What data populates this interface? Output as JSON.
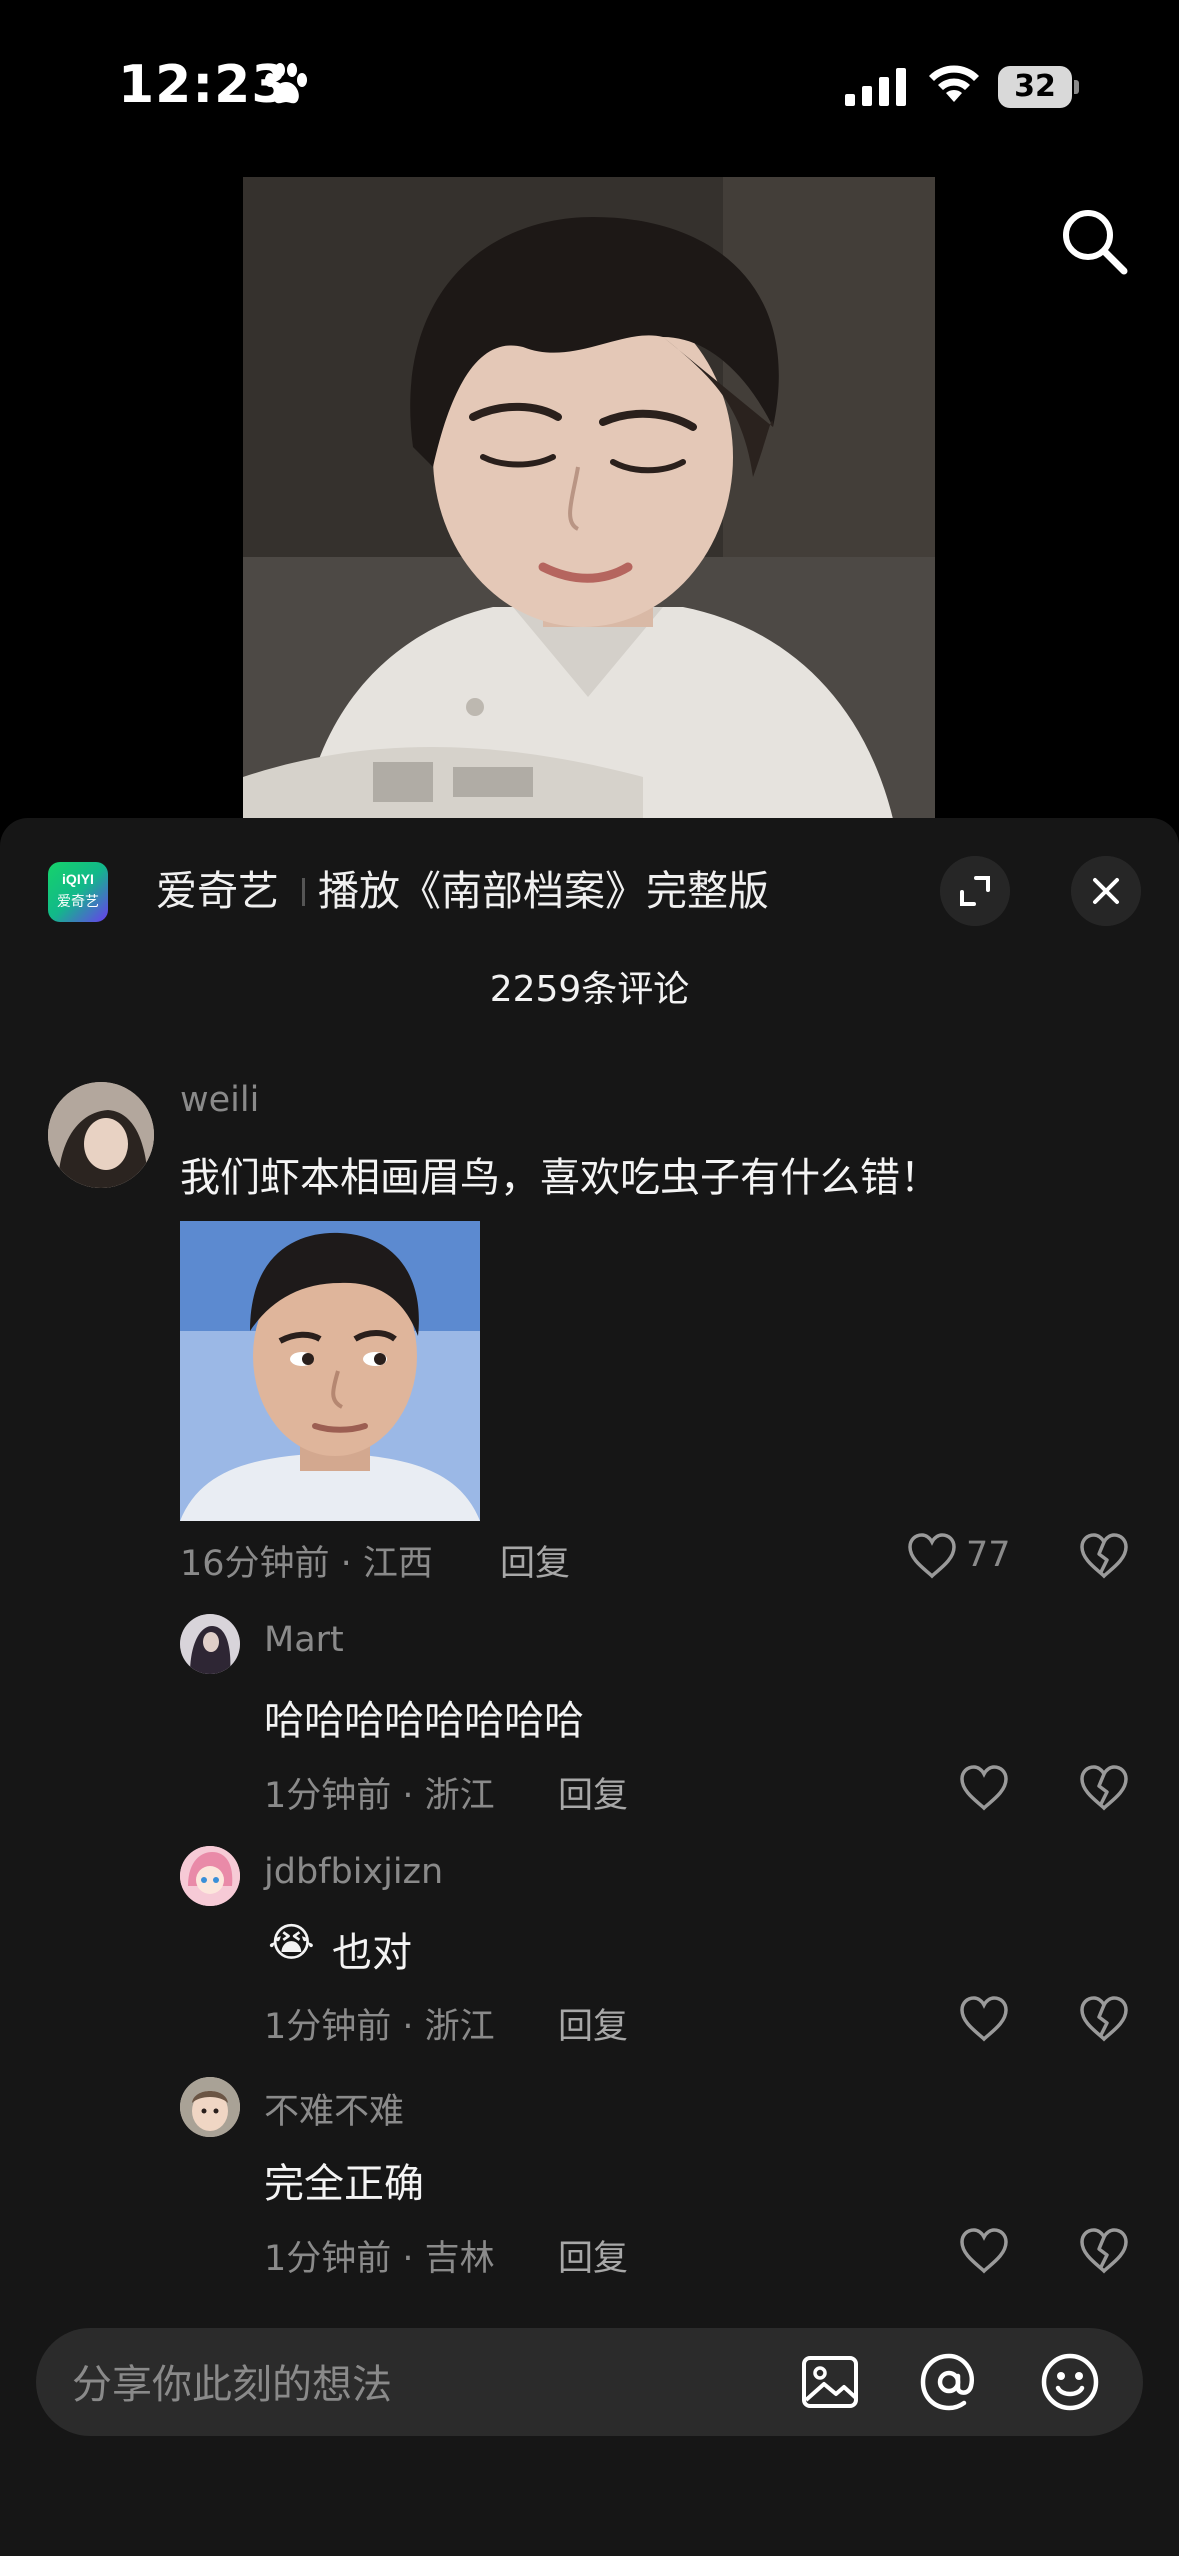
{
  "status_bar": {
    "time": "12:23",
    "battery": "32"
  },
  "app": {
    "name": "爱奇艺",
    "logo_text": "iQIYI",
    "logo_sub": "爱奇艺",
    "action": "播放《南部档案》完整版"
  },
  "comments_header": {
    "count_label": "2259条评论"
  },
  "comments": [
    {
      "username": "weili",
      "text": "我们虾本相画眉鸟，喜欢吃虫子有什么错！",
      "meta": "16分钟前 · 江西",
      "reply": "回复",
      "likes": "77"
    },
    {
      "username": "Mart",
      "text": "哈哈哈哈哈哈哈哈",
      "meta": "1分钟前 · 浙江",
      "reply": "回复"
    },
    {
      "username": "jdbfbixjizn",
      "text": "也对",
      "emoji": "😭",
      "meta": "1分钟前 · 浙江",
      "reply": "回复"
    },
    {
      "username": "不难不难",
      "text": "完全正确",
      "meta": "1分钟前 · 吉林",
      "reply": "回复"
    }
  ],
  "input": {
    "placeholder": "分享你此刻的想法"
  },
  "colors": {
    "background": "#000000",
    "sheet": "#161616",
    "muted_text": "#8a8a8a",
    "input_bg": "#2b2b2b"
  }
}
